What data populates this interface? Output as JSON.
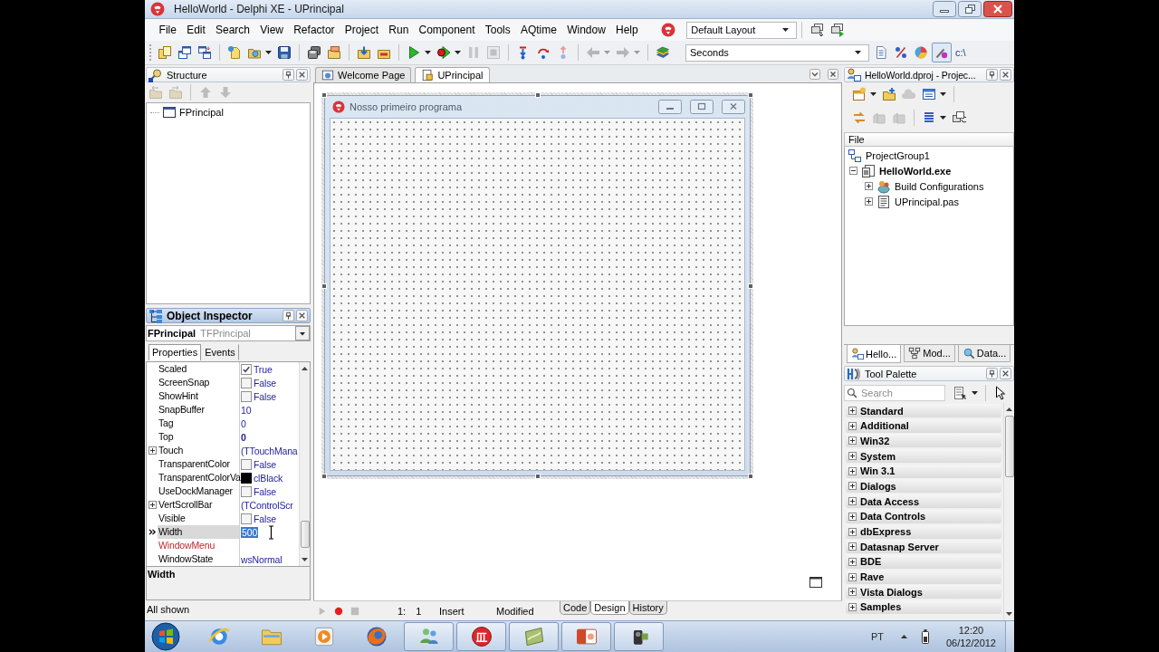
{
  "window": {
    "title": "HelloWorld - Delphi XE - UPrincipal"
  },
  "menu_bar": {
    "items": [
      "File",
      "Edit",
      "Search",
      "View",
      "Refactor",
      "Project",
      "Run",
      "Component",
      "Tools",
      "AQtime",
      "Window",
      "Help"
    ],
    "layout": "Default Layout"
  },
  "toolbar": {
    "groups": [
      [
        {
          "kind": "pages",
          "disabled": false,
          "menu": false
        },
        {
          "kind": "windows",
          "disabled": false,
          "menu": false
        },
        {
          "kind": "window-swap",
          "disabled": false,
          "menu": false
        }
      ],
      [
        {
          "kind": "new-item",
          "disabled": false,
          "menu": false
        },
        {
          "kind": "open-folder",
          "disabled": false,
          "menu": true
        },
        {
          "kind": "save",
          "disabled": false,
          "menu": false
        }
      ],
      [
        {
          "kind": "disks",
          "disabled": false,
          "menu": false
        },
        {
          "kind": "close-folder",
          "disabled": false,
          "menu": false
        }
      ],
      [
        {
          "kind": "add-file",
          "disabled": false,
          "menu": false
        },
        {
          "kind": "remove-file",
          "disabled": false,
          "menu": false
        }
      ],
      [
        {
          "kind": "run",
          "disabled": false,
          "menu": true
        },
        {
          "kind": "debug-run",
          "disabled": false,
          "menu": true
        },
        {
          "kind": "pause",
          "disabled": true,
          "menu": false
        },
        {
          "kind": "stop",
          "disabled": true,
          "menu": false
        }
      ],
      [
        {
          "kind": "step-into",
          "disabled": false,
          "menu": false
        },
        {
          "kind": "step-over",
          "disabled": false,
          "menu": false
        },
        {
          "kind": "step-out",
          "disabled": true,
          "menu": false
        }
      ],
      [
        {
          "kind": "back",
          "disabled": true,
          "menu": true
        },
        {
          "kind": "forward",
          "disabled": true,
          "menu": true
        }
      ],
      [
        {
          "kind": "books",
          "disabled": false,
          "menu": false
        }
      ]
    ],
    "timer_unit": "Seconds",
    "tools": [
      {
        "kind": "list-doc",
        "pressed": false
      },
      {
        "kind": "percent",
        "pressed": false
      },
      {
        "kind": "pie",
        "pressed": false
      },
      {
        "kind": "brush",
        "pressed": true
      }
    ],
    "path_label": "c:\\"
  },
  "structure": {
    "title": "Structure",
    "focused": false,
    "tools": [
      {
        "kind": "folder-left",
        "disabled": true
      },
      {
        "kind": "folder-right",
        "disabled": true
      },
      {
        "kind": "arrow-up",
        "disabled": true
      },
      {
        "kind": "arrow-down",
        "disabled": true
      }
    ],
    "tree": [
      {
        "label": "FPrincipal"
      }
    ]
  },
  "object_inspector": {
    "title": "Object Inspector",
    "focused": true,
    "object_name": "FPrincipal",
    "object_type": "TFPrincipal",
    "tabs": [
      {
        "label": "Properties",
        "selected": true
      },
      {
        "label": "Events",
        "selected": false
      }
    ],
    "properties": [
      {
        "name": "Scaled",
        "kind": "checkbox",
        "value": "True",
        "checked": true,
        "modified": false,
        "selected": false
      },
      {
        "name": "ScreenSnap",
        "kind": "checkbox",
        "value": "False",
        "checked": false,
        "modified": false,
        "selected": false
      },
      {
        "name": "ShowHint",
        "kind": "checkbox",
        "value": "False",
        "checked": false,
        "modified": false,
        "selected": false
      },
      {
        "name": "SnapBuffer",
        "kind": "text",
        "value": "10",
        "modified": false,
        "selected": false
      },
      {
        "name": "Tag",
        "kind": "text",
        "value": "0",
        "modified": false,
        "selected": false
      },
      {
        "name": "Top",
        "kind": "text",
        "value": "0",
        "modified": true,
        "selected": false
      },
      {
        "name": "Touch",
        "kind": "object",
        "value": "(TTouchMana",
        "modified": false,
        "selected": false
      },
      {
        "name": "TransparentColor",
        "kind": "checkbox",
        "value": "False",
        "checked": false,
        "modified": false,
        "selected": false
      },
      {
        "name": "TransparentColorVa",
        "kind": "color",
        "value": "clBlack",
        "color": "#000000",
        "modified": false,
        "selected": false
      },
      {
        "name": "UseDockManager",
        "kind": "checkbox",
        "value": "False",
        "checked": false,
        "modified": false,
        "selected": false
      },
      {
        "name": "VertScrollBar",
        "kind": "object",
        "value": "(TControlScr",
        "modified": false,
        "selected": false
      },
      {
        "name": "Visible",
        "kind": "checkbox",
        "value": "False",
        "checked": false,
        "modified": false,
        "selected": false
      },
      {
        "name": "Width",
        "kind": "text",
        "value": "500",
        "modified": false,
        "selected": true
      },
      {
        "name": "WindowMenu",
        "kind": "reference",
        "selected": false
      },
      {
        "name": "WindowState",
        "kind": "text",
        "value": "wsNormal",
        "modified": false,
        "selected": false
      }
    ],
    "description": "Width",
    "status": "All shown"
  },
  "editor": {
    "tabs": [
      {
        "label": "Welcome Page",
        "kind": "web",
        "selected": false
      },
      {
        "label": "UPrincipal",
        "kind": "unit",
        "selected": true
      }
    ],
    "form": {
      "title": "Nosso primeiro programa"
    },
    "macro_buttons": [
      {
        "kind": "play",
        "disabled": true
      },
      {
        "kind": "record",
        "disabled": false
      },
      {
        "kind": "stop",
        "disabled": true
      }
    ],
    "position": "1: 1",
    "mode": "Insert",
    "state": "Modified",
    "view_tabs": [
      {
        "label": "Code",
        "selected": false
      },
      {
        "label": "Design",
        "selected": true
      },
      {
        "label": "History",
        "selected": false
      }
    ]
  },
  "project_manager": {
    "title": "HelloWorld.dproj - Projec...",
    "focused": false,
    "tools": [
      [
        {
          "kind": "new-window",
          "disabled": false,
          "menu": true
        },
        {
          "kind": "add-folder",
          "disabled": false,
          "menu": false
        },
        {
          "kind": "cloud",
          "disabled": true,
          "menu": false
        },
        {
          "kind": "calendar-window",
          "disabled": false,
          "menu": true
        }
      ],
      [
        {
          "kind": "sync",
          "disabled": false,
          "menu": false
        },
        {
          "kind": "building",
          "disabled": true,
          "menu": false
        },
        {
          "kind": "building",
          "disabled": true,
          "menu": false
        },
        {
          "kind": "list-lines",
          "disabled": false,
          "menu": true
        },
        {
          "kind": "windows-refresh",
          "disabled": false,
          "menu": false
        }
      ]
    ],
    "column": "File",
    "tree": [
      {
        "label": "ProjectGroup1",
        "kind": "group",
        "children": [
          {
            "label": "HelloWorld.exe",
            "kind": "project",
            "active": true,
            "expanded": true,
            "children": [
              {
                "label": "Build Configurations",
                "kind": "configs",
                "expanded": false
              },
              {
                "label": "UPrincipal.pas",
                "kind": "unit",
                "expanded": false
              }
            ]
          }
        ]
      }
    ]
  },
  "side_tabs": [
    {
      "label": "Hello...",
      "kind": "project",
      "selected": true
    },
    {
      "label": "Mod...",
      "kind": "model",
      "selected": false
    },
    {
      "label": "Data...",
      "kind": "data",
      "selected": false
    }
  ],
  "tool_palette": {
    "title": "Tool Palette",
    "focused": false,
    "search": {
      "placeholder": "Search"
    },
    "categories": [
      "Standard",
      "Additional",
      "Win32",
      "System",
      "Win 3.1",
      "Dialogs",
      "Data Access",
      "Data Controls",
      "dbExpress",
      "Datasnap Server",
      "BDE",
      "Rave",
      "Vista Dialogs",
      "Samples"
    ]
  },
  "taskbar": {
    "apps": [
      {
        "kind": "globe",
        "running": false
      },
      {
        "kind": "folder",
        "running": false
      },
      {
        "kind": "media",
        "running": false
      },
      {
        "kind": "fox",
        "running": false
      },
      {
        "kind": "people",
        "running": true
      },
      {
        "kind": "red-emblem",
        "running": true
      },
      {
        "kind": "green-tile",
        "running": true
      },
      {
        "kind": "slides",
        "running": true
      },
      {
        "kind": "camera",
        "running": true
      }
    ],
    "language": "PT",
    "time": "12:20",
    "date": "06/12/2012"
  }
}
